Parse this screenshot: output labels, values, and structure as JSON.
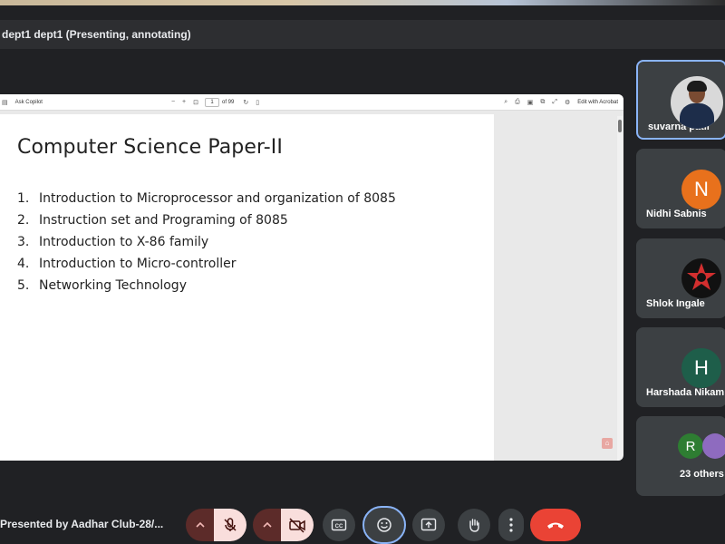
{
  "meeting": {
    "title": "dept1 dept1 (Presenting, annotating)",
    "presenting_label": "Presented by Aadhar Club-28/..."
  },
  "pdf_viewer": {
    "ask_copilot": "Ask Copilot",
    "zoom_out": "−",
    "zoom_in": "+",
    "page_current": "1",
    "page_total": "of 99",
    "edit_with_acrobat": "Edit with Acrobat"
  },
  "document": {
    "title": "Computer Science Paper-II",
    "items": [
      {
        "num": "1.",
        "text": "Introduction to Microprocessor and organization of 8085"
      },
      {
        "num": "2.",
        "text": "Instruction set and Programing of 8085"
      },
      {
        "num": "3.",
        "text": "Introduction to X-86 family"
      },
      {
        "num": "4.",
        "text": "Introduction to Micro-controller"
      },
      {
        "num": "5.",
        "text": "Networking Technology"
      }
    ]
  },
  "participants": [
    {
      "name": "suvarna patil",
      "avatar": "photo"
    },
    {
      "name": "Nidhi Sabnis",
      "initial": "N",
      "color": "#e8711c"
    },
    {
      "name": "Shlok Ingale",
      "avatar": "star-emblem"
    },
    {
      "name": "Harshada Nikam",
      "initial": "H",
      "color": "#1e5e4a"
    },
    {
      "name": "23 others",
      "initial": "R",
      "color": "#2e7d32"
    }
  ],
  "controls": {
    "mic": "mic-off-icon",
    "camera": "camera-off-icon",
    "captions": "captions-icon",
    "emoji": "emoji-icon",
    "present": "present-icon",
    "hand": "raise-hand-icon",
    "more": "more-vert-icon",
    "end_call": "end-call-icon"
  },
  "colors": {
    "background": "#202124",
    "tile": "#3c4043",
    "active_border": "#8ab4f8",
    "end_call": "#ea4335",
    "muted_pill": "#f9dedc"
  }
}
